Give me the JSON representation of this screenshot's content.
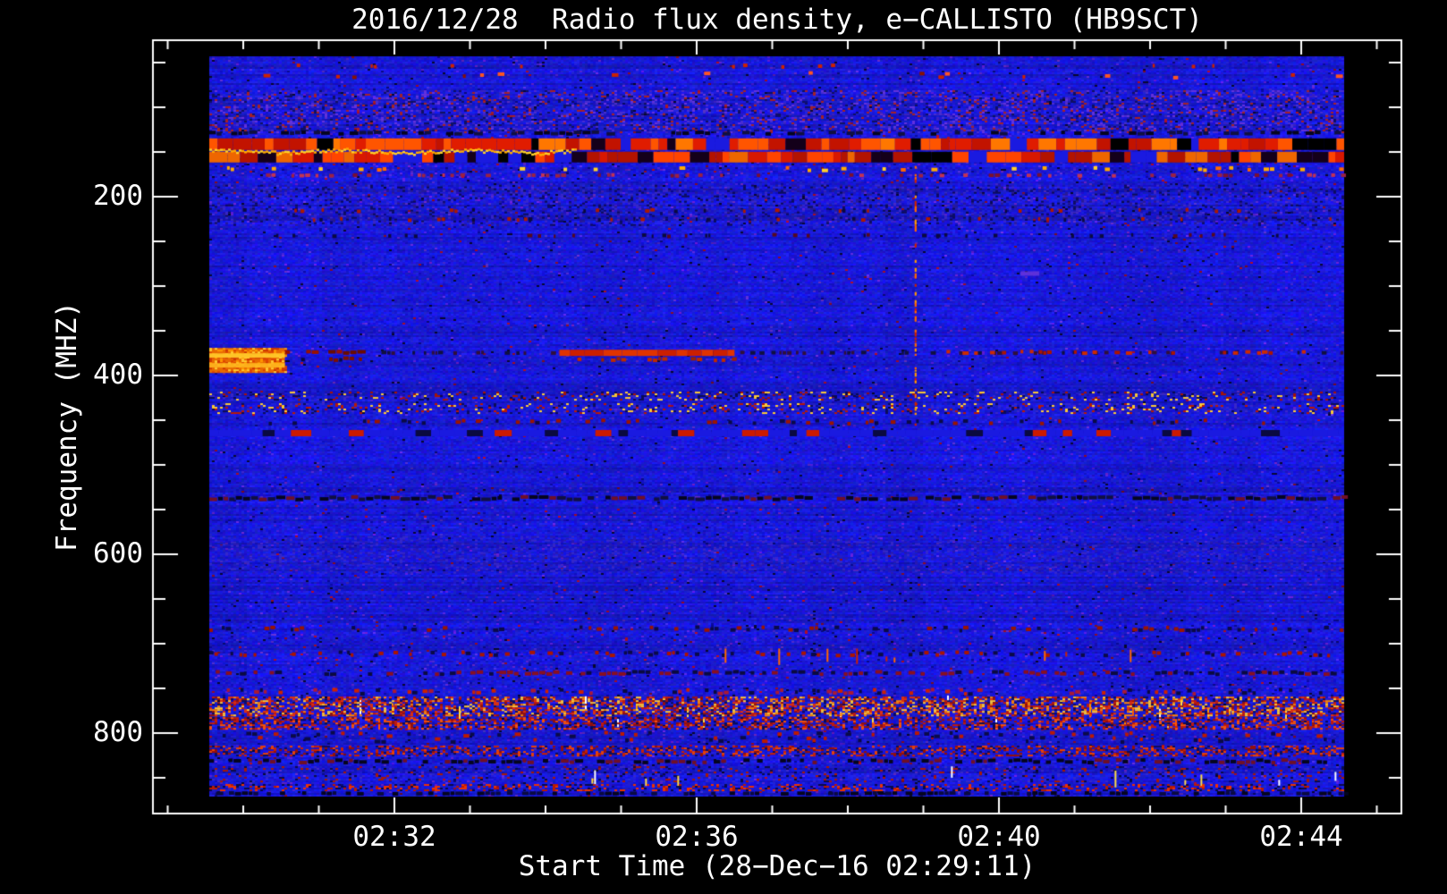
{
  "title": "2016/12/28  Radio flux density, e−CALLISTO (HB9SCT)",
  "chart_data": {
    "type": "heatmap",
    "subtype": "radio-spectrogram",
    "title": "2016/12/28  Radio flux density, e−CALLISTO (HB9SCT)",
    "xlabel": "Start Time (28−Dec−16 02:29:11)",
    "ylabel": "Frequency (MHZ)",
    "x_tick_labels": [
      "02:32",
      "02:36",
      "02:40",
      "02:44"
    ],
    "y_tick_labels": [
      "200",
      "400",
      "600",
      "800"
    ],
    "y_axis_inverted": true,
    "freq_range_mhz": [
      42,
      871
    ],
    "time_start": "02:29:11",
    "time_span_seconds": 901,
    "grid": false,
    "legend": "none",
    "colormap": {
      "background": "#000000",
      "base_blue": "#1a1ae0",
      "low_blue": "#0c0c90",
      "purple_noise": "#5a35d8",
      "red": "#cc1a00",
      "orange": "#ff8800",
      "yellow_peak": "#ffd028",
      "white_max": "#ffffff"
    },
    "bands": [
      {
        "name": "top-edge-red-dots",
        "f": [
          50,
          56
        ],
        "style": "dashes",
        "colors": [
          "#cc2200"
        ],
        "density": 0.05,
        "dash": [
          2,
          5
        ]
      },
      {
        "name": "top-sparse-red-dashes",
        "f": [
          58,
          68
        ],
        "style": "dashes",
        "colors": [
          "#cc2200",
          "#881100",
          "#ff5522"
        ],
        "density": 0.1,
        "dash": [
          3,
          8
        ]
      },
      {
        "name": "upper-purple-mottle",
        "f": [
          80,
          128
        ],
        "style": "speckle",
        "colors": [
          "#4a2ed0",
          "#3a22c0",
          "#6633dd",
          "#101060",
          "#aa2222"
        ],
        "density": 0.3
      },
      {
        "name": "dark-dash-row-145mhz",
        "f": [
          125,
          131
        ],
        "style": "dashes",
        "colors": [
          "#05051e",
          "#101040"
        ],
        "density": 0.5,
        "dash": [
          4,
          10
        ]
      },
      {
        "name": "rfi-red-band-row1",
        "f": [
          134,
          147
        ],
        "style": "blocks",
        "colors": [
          "#e01c00",
          "#ff5500",
          "#c21300",
          "#ff7700"
        ],
        "density": 0.8,
        "gap_colors": [
          "#14001a",
          "#1a1ae0",
          "#000000"
        ]
      },
      {
        "name": "rfi-red-band-row2",
        "f": [
          149,
          161
        ],
        "style": "blocks",
        "colors": [
          "#d81800",
          "#ff4400",
          "#b31300",
          "#ee6600"
        ],
        "density": 0.74,
        "gap_colors": [
          "#14001a",
          "#000000",
          "#1a1ae0"
        ]
      },
      {
        "name": "yellow-wavy-line",
        "f": [
          146,
          150
        ],
        "t": [
          0,
          290
        ],
        "style": "wave",
        "colors": [
          "#ffd028",
          "#ffaa00"
        ],
        "density": 0.9
      },
      {
        "name": "yellow-dot-row",
        "f": [
          165,
          172
        ],
        "style": "dashes",
        "colors": [
          "#ffaa00",
          "#ffd028",
          "#ff6600"
        ],
        "density": 0.13,
        "dash": [
          3,
          7
        ]
      },
      {
        "name": "pink-dot-row",
        "f": [
          173,
          178
        ],
        "style": "dashes",
        "colors": [
          "#c03355",
          "#992244",
          "#7a1030"
        ],
        "density": 0.28,
        "dash": [
          3,
          6
        ]
      },
      {
        "name": "purple-dot-band",
        "f": [
          186,
          232
        ],
        "style": "speckle",
        "colors": [
          "#3a28c8",
          "#0c0c58",
          "#2a1a90"
        ],
        "density": 0.22
      },
      {
        "name": "red-dot-row-a",
        "f": [
          212,
          218
        ],
        "style": "dashes",
        "colors": [
          "#aa1a00",
          "#0a0a40"
        ],
        "density": 0.12,
        "dash": [
          2,
          5
        ]
      },
      {
        "name": "red-dot-row-b",
        "f": [
          222,
          228
        ],
        "style": "dashes",
        "colors": [
          "#aa1a00",
          "#0a0a40"
        ],
        "density": 0.12,
        "dash": [
          2,
          5
        ]
      },
      {
        "name": "dark-dot-row-242mhz",
        "f": [
          240,
          246
        ],
        "style": "dashes",
        "colors": [
          "#0a0a40",
          "#550a20"
        ],
        "density": 0.2,
        "dash": [
          2,
          6
        ]
      },
      {
        "name": "speckle-row-420mhz",
        "f": [
          418,
          427
        ],
        "style": "speckle",
        "colors": [
          "#aa1500",
          "#0a0a50",
          "#3a28c8",
          "#ffcc33"
        ],
        "density": 0.3
      },
      {
        "name": "speckle-row-435mhz",
        "f": [
          431,
          442
        ],
        "style": "speckle",
        "colors": [
          "#bb1a00",
          "#0c0c58",
          "#ffcc33",
          "#3a28c8"
        ],
        "density": 0.26
      },
      {
        "name": "dot-row-450mhz",
        "f": [
          448,
          456
        ],
        "style": "dashes",
        "colors": [
          "#991500",
          "#0a0a48"
        ],
        "density": 0.26,
        "dash": [
          3,
          6
        ]
      },
      {
        "name": "red-dash-row-463mhz",
        "f": [
          461,
          468
        ],
        "style": "blocks",
        "colors": [
          "#cc1a00",
          "#0a0a40"
        ],
        "density": 0.3,
        "gap_colors": [
          "#1a1ae0"
        ]
      },
      {
        "name": "dashed-row-537mhz",
        "f": [
          534,
          541
        ],
        "style": "dashes",
        "colors": [
          "#701025",
          "#05051e",
          "#101040"
        ],
        "density": 0.85,
        "dash": [
          5,
          11
        ]
      },
      {
        "name": "faint-purple-band-600mhz",
        "f": [
          580,
          622
        ],
        "style": "speckle",
        "colors": [
          "#3828c8",
          "#2a1ab0"
        ],
        "density": 0.18
      },
      {
        "name": "dot-row-684mhz",
        "f": [
          680,
          688
        ],
        "style": "dashes",
        "colors": [
          "#0a0a48",
          "#991500"
        ],
        "density": 0.3,
        "dash": [
          3,
          6
        ]
      },
      {
        "name": "dot-row-712mhz",
        "f": [
          708,
          716
        ],
        "style": "dashes",
        "colors": [
          "#0a0a48",
          "#aa1500"
        ],
        "density": 0.35,
        "dash": [
          3,
          6
        ]
      },
      {
        "name": "red-specks-714mhz",
        "f": [
          706,
          722
        ],
        "t": [
          390,
          760
        ],
        "style": "vertdash",
        "colors": [
          "#cc2200",
          "#ff6600"
        ],
        "density": 0.05
      },
      {
        "name": "dot-row-733mhz",
        "f": [
          730,
          737
        ],
        "style": "dashes",
        "colors": [
          "#881020",
          "#0a0a40"
        ],
        "density": 0.5,
        "dash": [
          4,
          8
        ]
      },
      {
        "name": "dot-row-754mhz",
        "f": [
          750,
          759
        ],
        "style": "dashes",
        "colors": [
          "#aa1a33",
          "#0a0a40",
          "#cc2200"
        ],
        "density": 0.35,
        "dash": [
          3,
          6
        ]
      },
      {
        "name": "bright-vertical-ticks",
        "f": [
          758,
          800
        ],
        "style": "vertdash",
        "colors": [
          "#ff9900",
          "#ffdd44",
          "#ffffff",
          "#ff5500"
        ],
        "density": 0.06
      },
      {
        "name": "rfi-bottom-bright-band",
        "f": [
          760,
          781
        ],
        "style": "speckle",
        "colors": [
          "#ee3300",
          "#ff8800",
          "#ffcc33",
          "#cc1a00",
          "#0c0c58",
          "#991100"
        ],
        "density": 0.55
      },
      {
        "name": "rfi-bottom-red-band1",
        "f": [
          783,
          796
        ],
        "style": "speckle",
        "colors": [
          "#cc1a00",
          "#991100",
          "#0a0a50",
          "#ff5500"
        ],
        "density": 0.48
      },
      {
        "name": "rfi-bottom-dot-rows",
        "f": [
          798,
          813
        ],
        "style": "dashes",
        "colors": [
          "#bb1a00",
          "#0a0a48"
        ],
        "density": 0.4,
        "dash": [
          3,
          7
        ]
      },
      {
        "name": "rfi-bottom-red-band2",
        "f": [
          815,
          827
        ],
        "style": "speckle",
        "colors": [
          "#cc2200",
          "#ee4400",
          "#0c0c58",
          "#991100"
        ],
        "density": 0.42
      },
      {
        "name": "dark-row-830mhz",
        "f": [
          829,
          836
        ],
        "style": "dashes",
        "colors": [
          "#05051e",
          "#701025"
        ],
        "density": 0.7,
        "dash": [
          4,
          9
        ]
      },
      {
        "name": "sparse-row-845mhz",
        "f": [
          838,
          856
        ],
        "style": "speckle",
        "colors": [
          "#aa1a00",
          "#3828c8",
          "#0a0a48"
        ],
        "density": 0.16
      },
      {
        "name": "white-ticks-850mhz",
        "f": [
          838,
          862
        ],
        "t": [
          280,
          900
        ],
        "style": "vertdash",
        "colors": [
          "#ffffff",
          "#ffdd44"
        ],
        "density": 0.02
      },
      {
        "name": "red-row-862mhz",
        "f": [
          858,
          866
        ],
        "style": "speckle",
        "colors": [
          "#bb1a00",
          "#0a0a48",
          "#ee3300"
        ],
        "density": 0.32
      },
      {
        "name": "bottom-dark-row",
        "f": [
          866,
          871
        ],
        "style": "dashes",
        "colors": [
          "#05051e",
          "#0a0a40"
        ],
        "density": 0.6,
        "dash": [
          4,
          9
        ]
      }
    ],
    "features": [
      {
        "name": "burst-block",
        "t": [
          0,
          60
        ],
        "f": [
          369,
          397
        ],
        "style": "solid",
        "colors": [
          "#e86a00"
        ],
        "alpha": 1
      },
      {
        "name": "burst-block-speckle",
        "t": [
          0,
          60
        ],
        "f": [
          369,
          397
        ],
        "style": "speckle",
        "colors": [
          "#ff9900",
          "#dd4400",
          "#ffcc33",
          "#cc3300"
        ],
        "density": 0.5
      },
      {
        "name": "burst-block-core1",
        "t": [
          0,
          60
        ],
        "f": [
          375,
          380
        ],
        "style": "solid",
        "colors": [
          "#ffc828"
        ],
        "alpha": 0.95
      },
      {
        "name": "burst-block-core2",
        "t": [
          0,
          60
        ],
        "f": [
          386,
          391
        ],
        "style": "solid",
        "colors": [
          "#ffb81e"
        ],
        "alpha": 0.9
      },
      {
        "name": "burst-tail-dark-red",
        "t": [
          60,
          120
        ],
        "f": [
          371,
          377
        ],
        "style": "dashes",
        "colors": [
          "#991100",
          "#6a0c00"
        ],
        "density": 0.85,
        "dash": [
          5,
          10
        ]
      },
      {
        "name": "burst-tail-specks",
        "t": [
          60,
          120
        ],
        "f": [
          378,
          385
        ],
        "style": "dashes",
        "colors": [
          "#7a1100",
          "#0a0a40"
        ],
        "density": 0.4,
        "dash": [
          3,
          6
        ]
      },
      {
        "name": "mid-dark-dot-row-374mhz",
        "t": [
          120,
          901
        ],
        "f": [
          372,
          377
        ],
        "style": "dashes",
        "colors": [
          "#101040",
          "#30103a"
        ],
        "density": 0.3,
        "dash": [
          2,
          6
        ]
      },
      {
        "name": "mid-red-band",
        "t": [
          278,
          417
        ],
        "f": [
          371,
          378
        ],
        "style": "blocks",
        "colors": [
          "#cc1f00",
          "#e03300"
        ],
        "density": 0.85,
        "gap_colors": [
          "#881100"
        ]
      },
      {
        "name": "mid-red-band-speckle",
        "t": [
          278,
          417
        ],
        "f": [
          379,
          385
        ],
        "style": "dashes",
        "colors": [
          "#992200",
          "#bb2a00"
        ],
        "density": 0.5,
        "dash": [
          3,
          6
        ]
      },
      {
        "name": "right-red-dashed-374mhz",
        "t": [
          581,
          873
        ],
        "f": [
          371,
          377
        ],
        "style": "dashes",
        "colors": [
          "#aa1500",
          "#cc2a00"
        ],
        "density": 0.5,
        "dash": [
          3,
          7
        ]
      },
      {
        "name": "vertical-streak",
        "t": [
          560,
          562
        ],
        "f": [
          165,
          460
        ],
        "style": "vline",
        "colors": [
          "#ff6600",
          "#cc2200",
          "#ff9900"
        ],
        "density": 0.5
      },
      {
        "name": "purple-dash-285mhz",
        "t": [
          644,
          659
        ],
        "f": [
          283,
          288
        ],
        "style": "solid",
        "colors": [
          "#6a35d8"
        ],
        "alpha": 0.85
      }
    ]
  }
}
